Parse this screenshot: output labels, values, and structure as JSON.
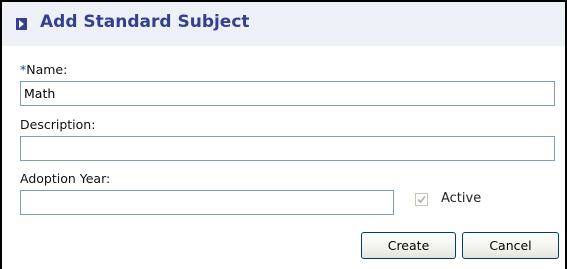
{
  "dialog": {
    "title": "Add Standard Subject"
  },
  "form": {
    "name": {
      "required_marker": "*",
      "label": "Name:",
      "value": "Math"
    },
    "description": {
      "label": "Description:",
      "value": ""
    },
    "adoption_year": {
      "label": "Adoption Year:",
      "value": ""
    },
    "active": {
      "label": "Active",
      "checked": true,
      "disabled": true
    }
  },
  "buttons": {
    "create_label": "Create",
    "cancel_label": "Cancel"
  },
  "colors": {
    "header_background": "#eef0f7",
    "title_text": "#34408e",
    "input_border": "#7f9db9",
    "button_border": "#003c74"
  },
  "icons": {
    "header": "triangle-right-icon",
    "checkbox": "checkmark-icon"
  }
}
